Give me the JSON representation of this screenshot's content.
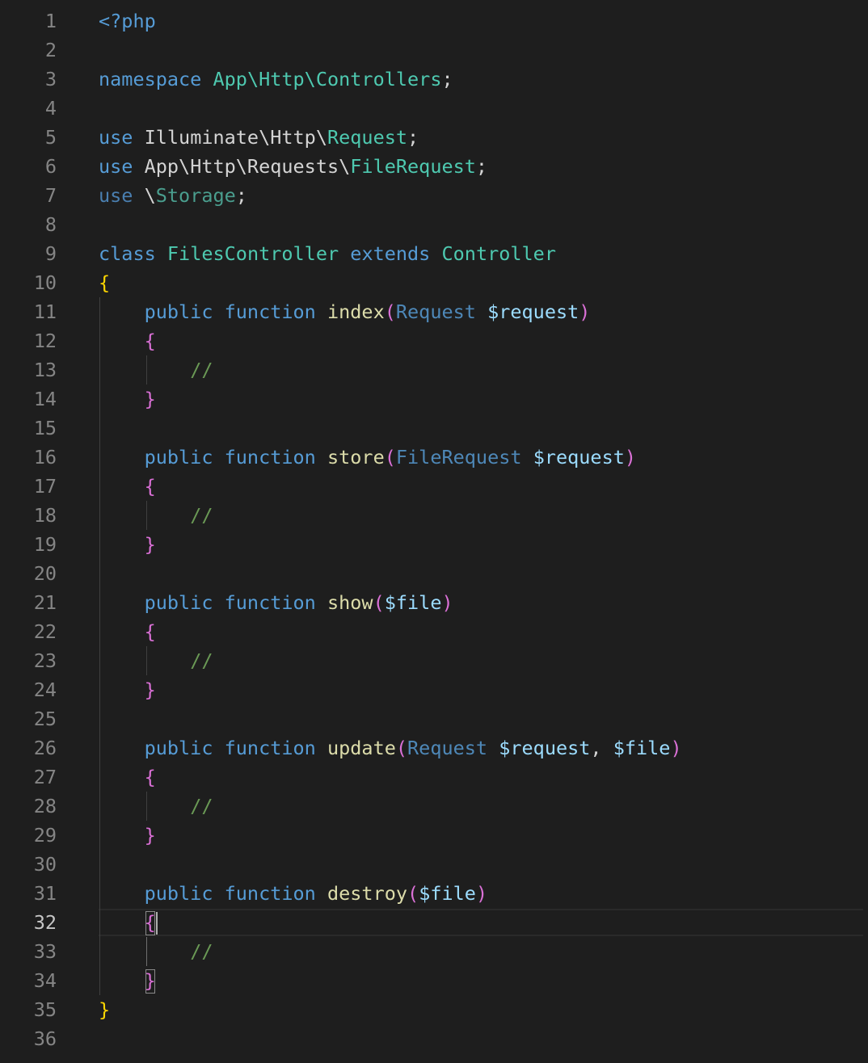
{
  "editor": {
    "language": "php",
    "cursor_line": 32,
    "colors": {
      "background": "#1e1e1e",
      "keyword": "#569cd6",
      "type": "#4ec9b0",
      "function": "#dcdcaa",
      "variable": "#9cdcfe",
      "comment": "#6a9955",
      "bracket_level_1": "#ffd700",
      "bracket_level_2": "#da70d6",
      "line_number": "#858585"
    },
    "lines": [
      {
        "n": "1",
        "tokens": [
          {
            "t": "<?php",
            "c": "kw"
          }
        ]
      },
      {
        "n": "2",
        "tokens": []
      },
      {
        "n": "3",
        "tokens": [
          {
            "t": "namespace",
            "c": "kw"
          },
          {
            "t": " ",
            "c": "pl"
          },
          {
            "t": "App\\Http\\Controllers",
            "c": "ty"
          },
          {
            "t": ";",
            "c": "pl"
          }
        ]
      },
      {
        "n": "4",
        "tokens": []
      },
      {
        "n": "5",
        "tokens": [
          {
            "t": "use",
            "c": "kw"
          },
          {
            "t": " Illuminate\\Http\\",
            "c": "pl"
          },
          {
            "t": "Request",
            "c": "ty"
          },
          {
            "t": ";",
            "c": "pl"
          }
        ]
      },
      {
        "n": "6",
        "tokens": [
          {
            "t": "use",
            "c": "kw"
          },
          {
            "t": " App\\Http\\Requests\\",
            "c": "pl"
          },
          {
            "t": "FileRequest",
            "c": "ty"
          },
          {
            "t": ";",
            "c": "pl"
          }
        ]
      },
      {
        "n": "7",
        "tokens": [
          {
            "t": "use",
            "c": "kw-dim"
          },
          {
            "t": " \\",
            "c": "pl"
          },
          {
            "t": "Storage",
            "c": "ty-dim"
          },
          {
            "t": ";",
            "c": "pl"
          }
        ]
      },
      {
        "n": "8",
        "tokens": []
      },
      {
        "n": "9",
        "tokens": [
          {
            "t": "class",
            "c": "kw"
          },
          {
            "t": " ",
            "c": "pl"
          },
          {
            "t": "FilesController",
            "c": "ty"
          },
          {
            "t": " ",
            "c": "pl"
          },
          {
            "t": "extends",
            "c": "kw"
          },
          {
            "t": " ",
            "c": "pl"
          },
          {
            "t": "Controller",
            "c": "ty"
          }
        ]
      },
      {
        "n": "10",
        "tokens": [
          {
            "t": "{",
            "c": "br1"
          }
        ]
      },
      {
        "n": "11",
        "tokens": [
          {
            "t": "    ",
            "c": "pl"
          },
          {
            "t": "public",
            "c": "kw"
          },
          {
            "t": " ",
            "c": "pl"
          },
          {
            "t": "function",
            "c": "kw"
          },
          {
            "t": " ",
            "c": "pl"
          },
          {
            "t": "index",
            "c": "fn"
          },
          {
            "t": "(",
            "c": "br2"
          },
          {
            "t": "Request",
            "c": "param-ty"
          },
          {
            "t": " ",
            "c": "pl"
          },
          {
            "t": "$request",
            "c": "var"
          },
          {
            "t": ")",
            "c": "br2"
          }
        ]
      },
      {
        "n": "12",
        "tokens": [
          {
            "t": "    ",
            "c": "pl"
          },
          {
            "t": "{",
            "c": "br2"
          }
        ]
      },
      {
        "n": "13",
        "tokens": [
          {
            "t": "        ",
            "c": "pl"
          },
          {
            "t": "//",
            "c": "cm"
          }
        ]
      },
      {
        "n": "14",
        "tokens": [
          {
            "t": "    ",
            "c": "pl"
          },
          {
            "t": "}",
            "c": "br2"
          }
        ]
      },
      {
        "n": "15",
        "tokens": []
      },
      {
        "n": "16",
        "tokens": [
          {
            "t": "    ",
            "c": "pl"
          },
          {
            "t": "public",
            "c": "kw"
          },
          {
            "t": " ",
            "c": "pl"
          },
          {
            "t": "function",
            "c": "kw"
          },
          {
            "t": " ",
            "c": "pl"
          },
          {
            "t": "store",
            "c": "fn"
          },
          {
            "t": "(",
            "c": "br2"
          },
          {
            "t": "FileRequest",
            "c": "param-ty"
          },
          {
            "t": " ",
            "c": "pl"
          },
          {
            "t": "$request",
            "c": "var"
          },
          {
            "t": ")",
            "c": "br2"
          }
        ]
      },
      {
        "n": "17",
        "tokens": [
          {
            "t": "    ",
            "c": "pl"
          },
          {
            "t": "{",
            "c": "br2"
          }
        ]
      },
      {
        "n": "18",
        "tokens": [
          {
            "t": "        ",
            "c": "pl"
          },
          {
            "t": "//",
            "c": "cm"
          }
        ]
      },
      {
        "n": "19",
        "tokens": [
          {
            "t": "    ",
            "c": "pl"
          },
          {
            "t": "}",
            "c": "br2"
          }
        ]
      },
      {
        "n": "20",
        "tokens": []
      },
      {
        "n": "21",
        "tokens": [
          {
            "t": "    ",
            "c": "pl"
          },
          {
            "t": "public",
            "c": "kw"
          },
          {
            "t": " ",
            "c": "pl"
          },
          {
            "t": "function",
            "c": "kw"
          },
          {
            "t": " ",
            "c": "pl"
          },
          {
            "t": "show",
            "c": "fn"
          },
          {
            "t": "(",
            "c": "br2"
          },
          {
            "t": "$file",
            "c": "var"
          },
          {
            "t": ")",
            "c": "br2"
          }
        ]
      },
      {
        "n": "22",
        "tokens": [
          {
            "t": "    ",
            "c": "pl"
          },
          {
            "t": "{",
            "c": "br2"
          }
        ]
      },
      {
        "n": "23",
        "tokens": [
          {
            "t": "        ",
            "c": "pl"
          },
          {
            "t": "//",
            "c": "cm"
          }
        ]
      },
      {
        "n": "24",
        "tokens": [
          {
            "t": "    ",
            "c": "pl"
          },
          {
            "t": "}",
            "c": "br2"
          }
        ]
      },
      {
        "n": "25",
        "tokens": []
      },
      {
        "n": "26",
        "tokens": [
          {
            "t": "    ",
            "c": "pl"
          },
          {
            "t": "public",
            "c": "kw"
          },
          {
            "t": " ",
            "c": "pl"
          },
          {
            "t": "function",
            "c": "kw"
          },
          {
            "t": " ",
            "c": "pl"
          },
          {
            "t": "update",
            "c": "fn"
          },
          {
            "t": "(",
            "c": "br2"
          },
          {
            "t": "Request",
            "c": "param-ty"
          },
          {
            "t": " ",
            "c": "pl"
          },
          {
            "t": "$request",
            "c": "var"
          },
          {
            "t": ", ",
            "c": "pl"
          },
          {
            "t": "$file",
            "c": "var"
          },
          {
            "t": ")",
            "c": "br2"
          }
        ]
      },
      {
        "n": "27",
        "tokens": [
          {
            "t": "    ",
            "c": "pl"
          },
          {
            "t": "{",
            "c": "br2"
          }
        ]
      },
      {
        "n": "28",
        "tokens": [
          {
            "t": "        ",
            "c": "pl"
          },
          {
            "t": "//",
            "c": "cm"
          }
        ]
      },
      {
        "n": "29",
        "tokens": [
          {
            "t": "    ",
            "c": "pl"
          },
          {
            "t": "}",
            "c": "br2"
          }
        ]
      },
      {
        "n": "30",
        "tokens": []
      },
      {
        "n": "31",
        "tokens": [
          {
            "t": "    ",
            "c": "pl"
          },
          {
            "t": "public",
            "c": "kw"
          },
          {
            "t": " ",
            "c": "pl"
          },
          {
            "t": "function",
            "c": "kw"
          },
          {
            "t": " ",
            "c": "pl"
          },
          {
            "t": "destroy",
            "c": "fn"
          },
          {
            "t": "(",
            "c": "br2"
          },
          {
            "t": "$file",
            "c": "var"
          },
          {
            "t": ")",
            "c": "br2"
          }
        ]
      },
      {
        "n": "32",
        "tokens": [
          {
            "t": "    ",
            "c": "pl"
          },
          {
            "t": "{",
            "c": "br2"
          }
        ]
      },
      {
        "n": "33",
        "tokens": [
          {
            "t": "        ",
            "c": "pl"
          },
          {
            "t": "//",
            "c": "cm"
          }
        ]
      },
      {
        "n": "34",
        "tokens": [
          {
            "t": "    ",
            "c": "pl"
          },
          {
            "t": "}",
            "c": "br2"
          }
        ]
      },
      {
        "n": "35",
        "tokens": [
          {
            "t": "}",
            "c": "br1"
          }
        ]
      },
      {
        "n": "36",
        "tokens": []
      }
    ]
  }
}
